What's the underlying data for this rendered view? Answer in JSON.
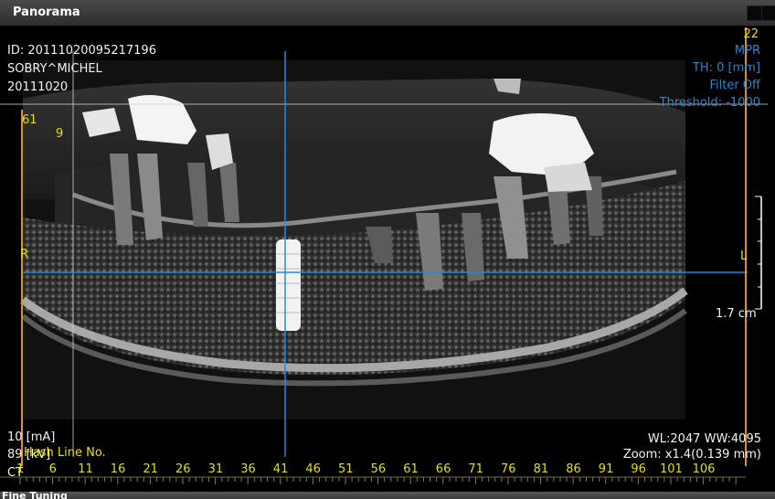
{
  "window": {
    "title": "Panorama"
  },
  "overlay": {
    "patient_id": "ID: 20111020095217196",
    "patient_name": "SOBRY^MICHEL",
    "study_date": "20111020",
    "slice_number": "22",
    "mode": "MPR",
    "thickness": "TH: 0 [mm]",
    "filter": "Filter Off",
    "threshold": "Threshold: -1000",
    "left_marker_top": "61",
    "left_marker_sub": "9",
    "side_right": "R",
    "side_left": "L",
    "scale_label": "1.7 cm",
    "current": "10 [mA]",
    "voltage": "89 [kV]",
    "hash_line": "Hash Line No.",
    "modality": "CT",
    "window_level": "WL:2047 WW:4095",
    "zoom": "Zoom: x1.4(0.139 mm)"
  },
  "ruler": {
    "labels": [
      "1",
      "6",
      "11",
      "16",
      "21",
      "26",
      "31",
      "36",
      "41",
      "46",
      "51",
      "56",
      "61",
      "66",
      "71",
      "76",
      "81",
      "86",
      "91",
      "96",
      "101",
      "106"
    ]
  },
  "bottom_panel": {
    "title": "Fine Tuning"
  },
  "colors": {
    "overlay_text": "#f2f2f2",
    "annotation_yellow": "#e8e000",
    "cursor_blue": "#2e86d0",
    "edge_orange": "#e0902a"
  }
}
